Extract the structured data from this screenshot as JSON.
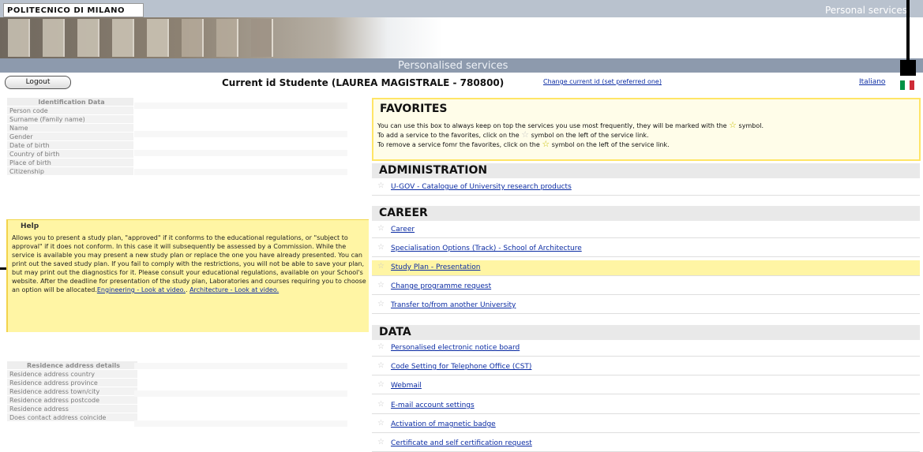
{
  "header": {
    "logo": "POLITECNICO DI MILANO",
    "top_right": "Personal services",
    "blue_title": "Personalised services"
  },
  "controls": {
    "logout": "Logout",
    "current_id": "Current id Studente (LAUREA MAGISTRALE - 780800)",
    "change_id": "Change current id (set preferred one)",
    "language": "Italiano"
  },
  "identification": {
    "title": "Identification Data",
    "rows": [
      "Person code",
      "Surname (Family name)",
      "Name",
      "Gender",
      "Date of birth",
      "Country of birth",
      "Place of birth",
      "Citizenship"
    ]
  },
  "help": {
    "title": "Help",
    "text_1": "Allows you to present a study plan, \"approved\" if it conforms to the educational regulations, or \"subject to approval\" if it does not conform. In this case it will subsequently be assessed by a Commission. While the service is available you may present a new study plan or replace the one you have already presented. You can print out the saved study plan. If you fail to comply with the restrictions, you will not be able to save your plan, but may print out the diagnostics for it. Please consult your educational regulations, available on your School's website. After the deadline for presentation of the study plan, Laboratories and courses requiring you to choose an option will be allocated.",
    "link_1": "Engineering - Look at video.",
    "sep": ". ",
    "link_2": "Architecture - Look at video."
  },
  "residence": {
    "title": "Residence address details",
    "rows": [
      "Residence address country",
      "Residence address province",
      "Residence address town/city",
      "Residence address postcode",
      "Residence address",
      "Does contact address coincide"
    ]
  },
  "favorites": {
    "title": "FAVORITES",
    "line_1a": "You can use this box to always keep on top the services you use most frequently, they will be marked with the",
    "line_1b": "symbol.",
    "line_2a": "To add a service to the favorites, click on the",
    "line_2b": "symbol on the left of the service link.",
    "line_3a": "To remove a service fomr the favorites, click on the",
    "line_3b": "symbol on the left of the service link."
  },
  "sections": {
    "administration": {
      "title": "ADMINISTRATION",
      "items": [
        "U-GOV - Catalogue of University research products"
      ]
    },
    "career": {
      "title": "CAREER",
      "items": [
        "Career",
        "Specialisation Options (Track) - School of Architecture",
        "Study Plan - Presentation",
        "Change programme request",
        "Transfer to/from another University"
      ]
    },
    "data": {
      "title": "DATA",
      "items": [
        "Personalised electronic notice board",
        "Code Setting for Telephone Office (CST)",
        "Webmail",
        "E-mail account settings",
        "Activation of magnetic badge",
        "Certificate and self certification request"
      ]
    }
  },
  "colors": {
    "link": "#0a2ba3",
    "highlight": "#fff5a4",
    "header_blue": "#8d9aad"
  }
}
